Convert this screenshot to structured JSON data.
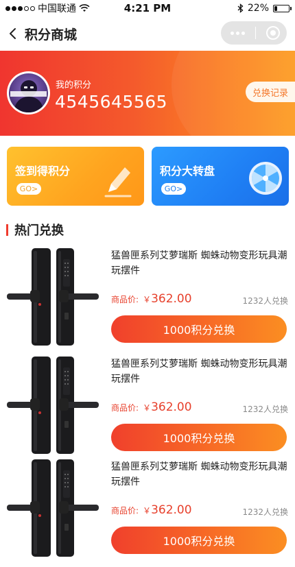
{
  "status_bar": {
    "carrier": "中国联通",
    "time": "4:21 PM",
    "battery_text": "22%",
    "battery_level": 0.22,
    "icons": [
      "signal-dots",
      "wifi-icon",
      "bluetooth-icon",
      "battery-icon"
    ]
  },
  "nav": {
    "title": "积分商城",
    "back_icon": "chevron-left-icon",
    "capsule_icons": [
      "more-dots-icon",
      "close-target-icon"
    ]
  },
  "points": {
    "label": "我的积分",
    "value": "4545645565",
    "history_button": "兑换记录"
  },
  "cards": [
    {
      "title": "签到得积分",
      "go": "GO>",
      "icon": "pencil-icon",
      "color": "#ffab22"
    },
    {
      "title": "积分大转盘",
      "go": "GO>",
      "icon": "wheel-icon",
      "color": "#1f7ff4"
    }
  ],
  "section": {
    "title": "热门兑换"
  },
  "products": [
    {
      "name": "猛兽匣系列艾萝瑞斯 蜘蛛动物变形玩具潮玩摆件",
      "price_label": "商品价:",
      "currency": "￥",
      "price": "362.00",
      "count": "1232人兑换",
      "button": "1000积分兑换",
      "image": "smart-lock-image"
    },
    {
      "name": "猛兽匣系列艾萝瑞斯 蜘蛛动物变形玩具潮玩摆件",
      "price_label": "商品价:",
      "currency": "￥",
      "price": "362.00",
      "count": "1232人兑换",
      "button": "1000积分兑换",
      "image": "smart-lock-image"
    },
    {
      "name": "猛兽匣系列艾萝瑞斯 蜘蛛动物变形玩具潮玩摆件",
      "price_label": "商品价:",
      "currency": "￥",
      "price": "362.00",
      "count": "1232人兑换",
      "button": "1000积分兑换",
      "image": "smart-lock-image"
    }
  ],
  "colors": {
    "accent_red": "#e7402c",
    "banner_start": "#f0352f",
    "banner_end": "#fd9c21",
    "section_bar": "#ef3b2d"
  }
}
